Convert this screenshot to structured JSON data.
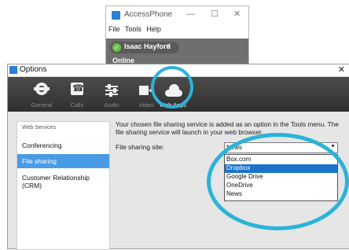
{
  "bg_window": {
    "title": "AccessPhone",
    "controls": [
      "—",
      "☐",
      "✕"
    ],
    "menu": [
      "File",
      "Tools",
      "Help"
    ],
    "user_name": "Isaac Hayford",
    "status": "Online"
  },
  "dialog": {
    "title": "Options",
    "close_glyph": "✕",
    "toolbar": [
      {
        "label": "General",
        "icon": "gear-icon"
      },
      {
        "label": "Calls",
        "icon": "phone-icon"
      },
      {
        "label": "Audio",
        "icon": "sliders-icon"
      },
      {
        "label": "Video",
        "icon": "video-camera-icon"
      },
      {
        "label": "Web Apps",
        "icon": "cloud-icon"
      }
    ],
    "sidebar": {
      "header": "Web Services",
      "items": [
        "Conferencing",
        "File sharing",
        "Customer Relationship (CRM)"
      ],
      "selected": "File sharing"
    },
    "content": {
      "description": "Your chosen file sharing service is added as an option in the Tools menu. The file sharing service will launch in your web browser.",
      "field_label": "File sharing site:",
      "combo_value": "News",
      "options": [
        "Box.com",
        "Dropbox",
        "Google Drive",
        "OneDrive",
        "News"
      ],
      "highlighted_option": "Dropbox"
    }
  },
  "colors": {
    "highlight_ring": "#2bb3d8",
    "selection_blue": "#4a9be6",
    "toolbar_dark": "#3a3a3a"
  }
}
